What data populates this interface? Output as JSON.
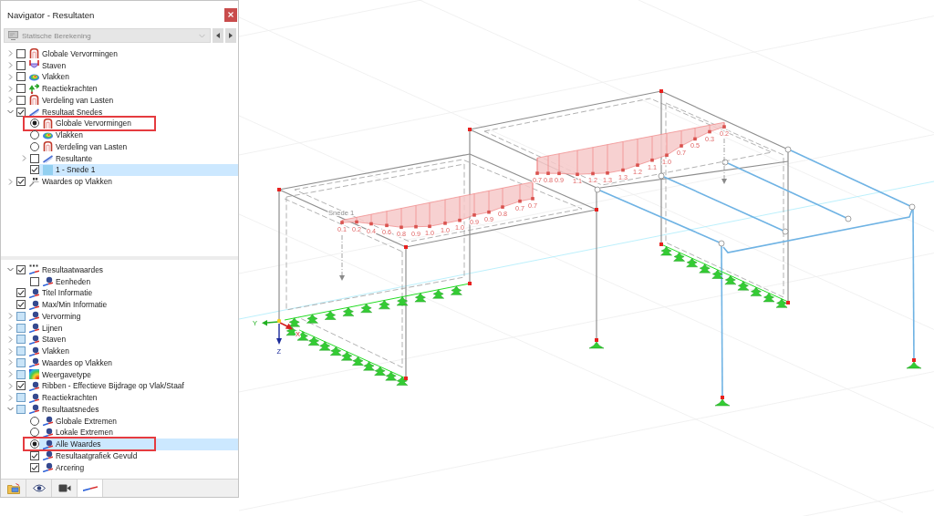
{
  "window": {
    "title": "Navigator - Resultaten"
  },
  "case_selector": {
    "value": "Statische Berekening"
  },
  "results_tree": [
    {
      "label": "Globale Vervormingen",
      "icon": {
        "kind": "deformation"
      },
      "kind": "checkbox",
      "checked": false,
      "partial": false,
      "expanded": false,
      "selected": false
    },
    {
      "label": "Staven",
      "icon": {
        "kind": "member"
      },
      "kind": "checkbox",
      "checked": false,
      "partial": false,
      "expanded": false,
      "selected": false
    },
    {
      "label": "Vlakken",
      "icon": {
        "kind": "surface"
      },
      "kind": "checkbox",
      "checked": false,
      "partial": false,
      "expanded": false,
      "selected": false
    },
    {
      "label": "Reactiekrachten",
      "icon": {
        "kind": "reaction"
      },
      "kind": "checkbox",
      "checked": false,
      "partial": false,
      "expanded": false,
      "selected": false
    },
    {
      "label": "Verdeling van Lasten",
      "icon": {
        "kind": "deformation"
      },
      "kind": "checkbox",
      "checked": false,
      "partial": false,
      "expanded": false,
      "selected": false
    },
    {
      "label": "Resultaat Snedes",
      "icon": {
        "kind": "section"
      },
      "kind": "checkbox",
      "checked": true,
      "partial": false,
      "expanded": true,
      "selected": false,
      "children": [
        {
          "label": "Globale Vervormingen",
          "icon": {
            "kind": "deformation"
          },
          "kind": "radio",
          "checked": true,
          "selected": false,
          "outlined": true
        },
        {
          "label": "Vlakken",
          "icon": {
            "kind": "surface"
          },
          "kind": "radio",
          "checked": false,
          "selected": false
        },
        {
          "label": "Verdeling van Lasten",
          "icon": {
            "kind": "deformation"
          },
          "kind": "radio",
          "checked": false,
          "selected": false
        },
        {
          "label": "Resultante",
          "icon": {
            "kind": "section"
          },
          "kind": "checkbox",
          "checked": false,
          "partial": false,
          "expanded": false,
          "selected": false
        },
        {
          "label": "1 - Snede 1",
          "icon": {
            "kind": "swatch"
          },
          "kind": "checkbox",
          "checked": true,
          "partial": false,
          "selected": true
        }
      ]
    },
    {
      "label": "Waardes op Vlakken",
      "icon": {
        "kind": "values"
      },
      "kind": "checkbox",
      "checked": true,
      "partial": false,
      "expanded": false,
      "selected": false
    }
  ],
  "display_tree": [
    {
      "label": "Resultaatwaardes",
      "icon": {
        "kind": "numbers"
      },
      "kind": "checkbox",
      "checked": true,
      "partial": false,
      "expanded": true,
      "selected": false,
      "children": [
        {
          "label": "Eenheden",
          "icon": {
            "kind": "display"
          },
          "kind": "checkbox",
          "checked": false,
          "partial": false,
          "selected": false
        }
      ]
    },
    {
      "label": "Titel Informatie",
      "icon": {
        "kind": "display"
      },
      "kind": "checkbox",
      "checked": true,
      "partial": false,
      "selected": false
    },
    {
      "label": "Max/Min Informatie",
      "icon": {
        "kind": "display"
      },
      "kind": "checkbox",
      "checked": true,
      "partial": false,
      "selected": false
    },
    {
      "label": "Vervorming",
      "icon": {
        "kind": "display"
      },
      "kind": "checkbox",
      "checked": false,
      "partial": true,
      "expanded": false,
      "selected": false
    },
    {
      "label": "Lijnen",
      "icon": {
        "kind": "display"
      },
      "kind": "checkbox",
      "checked": false,
      "partial": true,
      "expanded": false,
      "selected": false
    },
    {
      "label": "Staven",
      "icon": {
        "kind": "display"
      },
      "kind": "checkbox",
      "checked": false,
      "partial": true,
      "expanded": false,
      "selected": false
    },
    {
      "label": "Vlakken",
      "icon": {
        "kind": "display"
      },
      "kind": "checkbox",
      "checked": false,
      "partial": true,
      "expanded": false,
      "selected": false
    },
    {
      "label": "Waardes op Vlakken",
      "icon": {
        "kind": "display"
      },
      "kind": "checkbox",
      "checked": false,
      "partial": true,
      "expanded": false,
      "selected": false
    },
    {
      "label": "Weergavetype",
      "icon": {
        "kind": "rainbow"
      },
      "kind": "checkbox",
      "checked": false,
      "partial": true,
      "expanded": false,
      "selected": false
    },
    {
      "label": "Ribben - Effectieve Bijdrage op Vlak/Staaf",
      "icon": {
        "kind": "display"
      },
      "kind": "checkbox",
      "checked": true,
      "partial": false,
      "expanded": false,
      "selected": false
    },
    {
      "label": "Reactiekrachten",
      "icon": {
        "kind": "display"
      },
      "kind": "checkbox",
      "checked": false,
      "partial": true,
      "expanded": false,
      "selected": false
    },
    {
      "label": "Resultaatsnedes",
      "icon": {
        "kind": "display"
      },
      "kind": "checkbox",
      "checked": false,
      "partial": true,
      "expanded": true,
      "selected": false,
      "children": [
        {
          "label": "Globale Extremen",
          "icon": {
            "kind": "display"
          },
          "kind": "radio",
          "checked": false,
          "selected": false
        },
        {
          "label": "Lokale Extremen",
          "icon": {
            "kind": "display"
          },
          "kind": "radio",
          "checked": false,
          "selected": false
        },
        {
          "label": "Alle Waardes",
          "icon": {
            "kind": "display"
          },
          "kind": "radio",
          "checked": true,
          "selected": true,
          "outlined": true
        },
        {
          "label": "Resultaatgrafiek Gevuld",
          "icon": {
            "kind": "display"
          },
          "kind": "checkbox",
          "checked": true,
          "partial": false,
          "selected": false
        },
        {
          "label": "Arcering",
          "icon": {
            "kind": "display"
          },
          "kind": "checkbox",
          "checked": true,
          "partial": false,
          "selected": false
        }
      ]
    }
  ],
  "bottom_tabs": [
    {
      "kind": "model",
      "selected": false
    },
    {
      "kind": "view",
      "selected": false
    },
    {
      "kind": "camera",
      "selected": false
    },
    {
      "kind": "results",
      "selected": true
    }
  ],
  "viewport": {
    "section_label": "Snede 1",
    "axis_labels": {
      "y": "Y",
      "x": "X",
      "z": "Z"
    },
    "section_results": [
      {
        "values": [
          "0.1",
          "0.2",
          "0.4",
          "0.6",
          "0.8",
          "0.9",
          "1.0",
          "1.0",
          "1.0",
          "0.9",
          "0.9",
          "0.8",
          "0.7",
          "0.7"
        ]
      },
      {
        "values": [
          "0.7",
          "0.8",
          "0.9",
          "1.1",
          "1.2",
          "1.3",
          "1.3",
          "1.2",
          "1.1",
          "1.0",
          "0.7",
          "0.5",
          "0.3",
          "0.2"
        ]
      }
    ]
  }
}
